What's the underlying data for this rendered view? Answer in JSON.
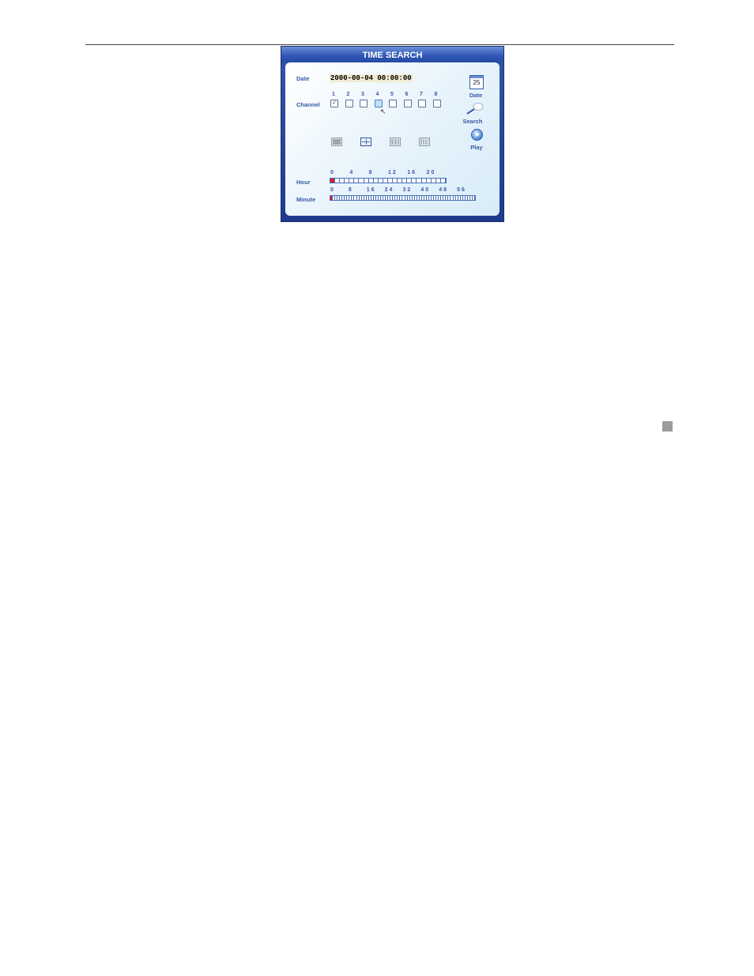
{
  "dialog": {
    "title": "TIME SEARCH",
    "date_label": "Date",
    "datetime_value": "2000-00-04 00:00:00",
    "channel_label": "Channel",
    "channels": [
      "1",
      "2",
      "3",
      "4",
      "5",
      "6",
      "7",
      "8"
    ],
    "channel_checked": [
      true,
      false,
      false,
      false,
      false,
      false,
      false,
      false
    ],
    "focused_channel": "4",
    "layout_buttons": [
      "single-view",
      "quad-view",
      "nine-view",
      "sixteen-view"
    ],
    "active_layout": "quad-view",
    "side_buttons": {
      "calendar_day": "25",
      "date_label": "Date",
      "search_label": "Search",
      "play_label": "Play"
    },
    "hour": {
      "label": "Hour",
      "ticks": [
        "0",
        "4",
        "8",
        "12",
        "16",
        "20"
      ],
      "cells": 24,
      "selected": 0
    },
    "minute": {
      "label": "Minute",
      "ticks": [
        "0",
        "8",
        "16",
        "24",
        "32",
        "40",
        "48",
        "56"
      ],
      "cells": 60,
      "selected": 0
    },
    "colors": {
      "frame": "#2a4aa0",
      "label": "#3a5aa8",
      "selected_cell": "#d42020"
    }
  }
}
